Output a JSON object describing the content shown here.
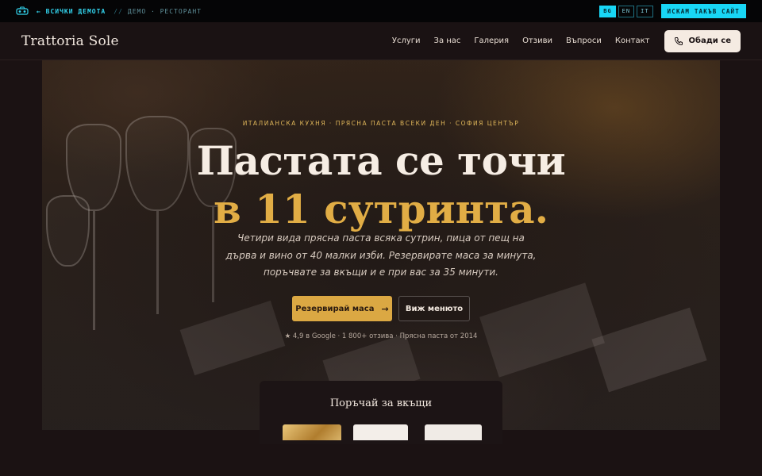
{
  "demo_bar": {
    "back_label": "← ВСИЧКИ ДЕМОТА",
    "separator": "//",
    "crumb": "ДЕМО · РЕСТОРАНТ",
    "languages": [
      {
        "code": "BG",
        "active": true
      },
      {
        "code": "EN",
        "active": false
      },
      {
        "code": "IT",
        "active": false
      }
    ],
    "cta_label": "ИСКАМ ТАКЪВ САЙТ"
  },
  "header": {
    "logo": "Trattoria Sole",
    "nav": [
      "Услуги",
      "За нас",
      "Галерия",
      "Отзиви",
      "Въпроси",
      "Контакт"
    ],
    "call_label": "Обади се"
  },
  "hero": {
    "eyebrow": "ИТАЛИАНСКА КУХНЯ · ПРЯСНА ПАСТА ВСЕКИ ДЕН · СОФИЯ ЦЕНТЪР",
    "title_line1": "Пастата се точи",
    "title_line2": "в 11 сутринта.",
    "lede": "Четири вида прясна паста всяка сутрин, пица от пещ на дърва и вино от 40 малки изби. Резервирате маса за минута, поръчвате за вкъщи и е при вас за 35 минути.",
    "primary_cta": "Резервирай маса",
    "secondary_cta": "Виж менюто",
    "proof": "★ 4,9 в Google · 1 800+ отзива · Прясна паста от 2014"
  },
  "order": {
    "title": "Поръчай за вкъщи"
  },
  "colors": {
    "accent_gold": "#dba843",
    "demo_cyan": "#18d6f5",
    "background": "#1b1213"
  }
}
